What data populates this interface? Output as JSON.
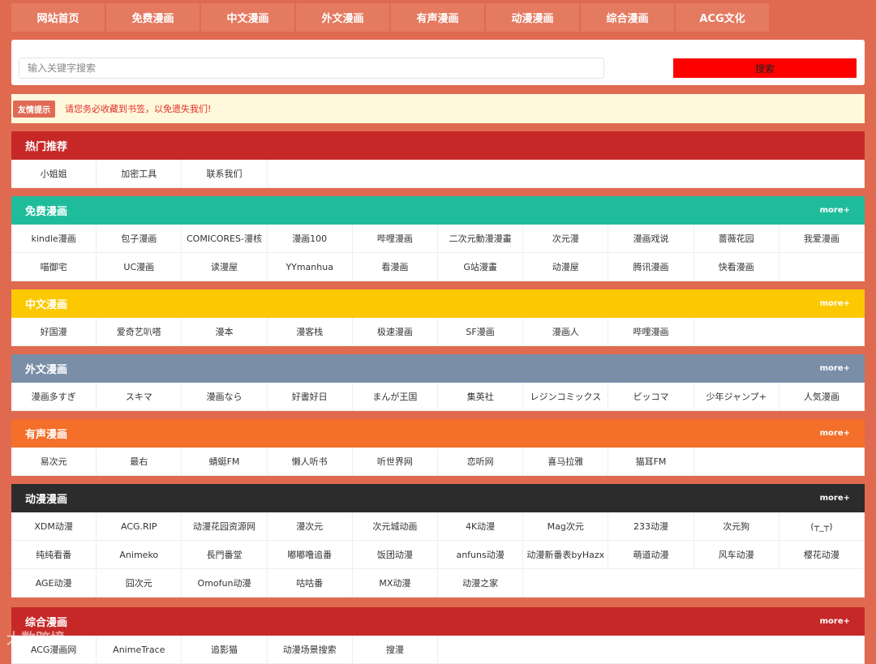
{
  "nav": [
    "网站首页",
    "免费漫画",
    "中文漫画",
    "外文漫画",
    "有声漫画",
    "动漫漫画",
    "综合漫画",
    "ACG文化"
  ],
  "search": {
    "placeholder": "输入关键字搜索",
    "button": "搜索"
  },
  "notice": {
    "badge": "友情提示",
    "text": "请您务必收藏到书签，以免遗失我们!"
  },
  "colors": {
    "background": "#df6a50",
    "hot": "#c62828",
    "free": "#1fbc9c",
    "chinese": "#fcc900",
    "foreign": "#7a8ea8",
    "audio": "#f36f2a",
    "anime": "#2c2c2c",
    "general": "#c62828",
    "search_button": "#ff0000"
  },
  "sections": [
    {
      "key": "hot",
      "title": "热门推荐",
      "more": "",
      "items": [
        "小姐姐",
        "加密工具",
        "联系我们"
      ]
    },
    {
      "key": "free",
      "title": "免费漫画",
      "more": "more+",
      "items": [
        "kindle漫画",
        "包子漫画",
        "COMICORES-漫核",
        "漫画100",
        "哔哩漫画",
        "二次元動漫漫畫",
        "次元漫",
        "漫画戏说",
        "蔷薇花园",
        "我爱漫画",
        "喵御宅",
        "UC漫画",
        "读漫屋",
        "YYmanhua",
        "看漫画",
        "G站漫畫",
        "动漫屋",
        "腾讯漫画",
        "快看漫画"
      ]
    },
    {
      "key": "chinese",
      "title": "中文漫画",
      "more": "more+",
      "items": [
        "好国漫",
        "爱奇艺叭嗒",
        "漫本",
        "漫客栈",
        "极速漫画",
        "SF漫画",
        "漫画人",
        "哔哩漫画"
      ]
    },
    {
      "key": "foreign",
      "title": "外文漫画",
      "more": "more+",
      "items": [
        "漫画多すぎ",
        "スキマ",
        "漫画なら",
        "好書好日",
        "まんが王国",
        "集英社",
        "レジンコミックス",
        "ピッコマ",
        "少年ジャンプ+",
        "人気漫画"
      ]
    },
    {
      "key": "audio",
      "title": "有声漫画",
      "more": "more+",
      "items": [
        "易次元",
        "最右",
        "蜻蜓FM",
        "懒人听书",
        "听世界网",
        "恋听网",
        "喜马拉雅",
        "猫耳FM"
      ]
    },
    {
      "key": "anime",
      "title": "动漫漫画",
      "more": "more+",
      "items": [
        "XDM动漫",
        "ACG.RIP",
        "动漫花园资源网",
        "漫次元",
        "次元城动画",
        "4K动漫",
        "Mag次元",
        "233动漫",
        "次元狗",
        "(┬_┬)",
        "纯纯看番",
        "Animeko",
        "長門番堂",
        "嘟嘟噜追番",
        "饭团动漫",
        "anfuns动漫",
        "动漫新番表byHazx",
        "萌道动漫",
        "风车动漫",
        "樱花动漫",
        "AGE动漫",
        "囧次元",
        "Omofun动漫",
        "咕咕番",
        "MX动漫",
        "动漫之家"
      ]
    },
    {
      "key": "general",
      "title": "综合漫画",
      "more": "more+",
      "items": [
        "ACG漫画网",
        "AnimeTrace",
        "追影猫",
        "动漫场景搜索",
        "搜漫"
      ]
    }
  ],
  "watermark": "大数跨境"
}
